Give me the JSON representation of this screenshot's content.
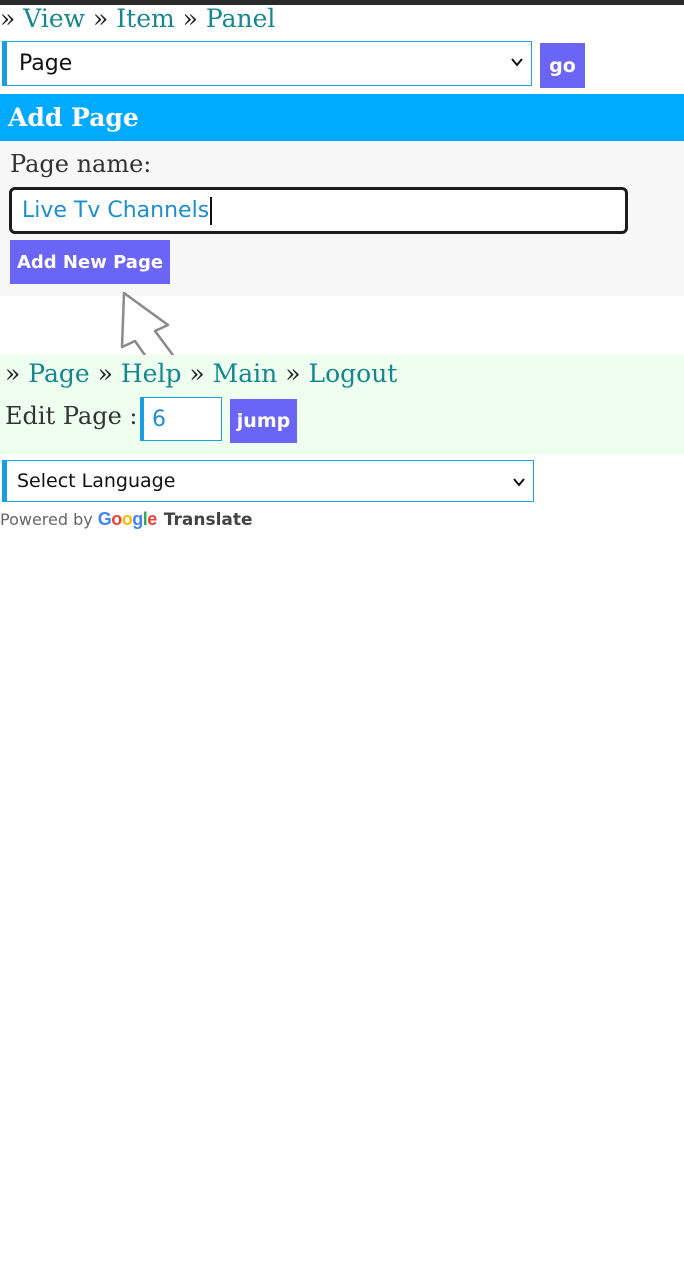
{
  "top_nav": {
    "sep": "»",
    "items": [
      "View",
      "Item",
      "Panel"
    ]
  },
  "page_select": {
    "selected": "Page",
    "go_label": "go"
  },
  "add_panel": {
    "title": "Add Page",
    "name_label": "Page name:",
    "name_value": "Live Tv Channels",
    "submit_label": "Add New Page"
  },
  "footer_nav": {
    "sep": "»",
    "items": [
      "Page",
      "Help",
      "Main",
      "Logout"
    ]
  },
  "edit_page": {
    "label": "Edit Page :",
    "value": "6",
    "jump_label": "jump"
  },
  "language": {
    "selected": "Select Language",
    "powered_by": "Powered by",
    "google_letters": [
      "G",
      "o",
      "o",
      "g",
      "l",
      "e"
    ],
    "google_colors": [
      "#4285f4",
      "#ea4335",
      "#fbbc05",
      "#4285f4",
      "#34a853",
      "#ea4335"
    ],
    "translate_label": "Translate"
  },
  "colors": {
    "accent_blue": "#00aaff",
    "button": "#6a65f5",
    "link": "#17878f"
  }
}
